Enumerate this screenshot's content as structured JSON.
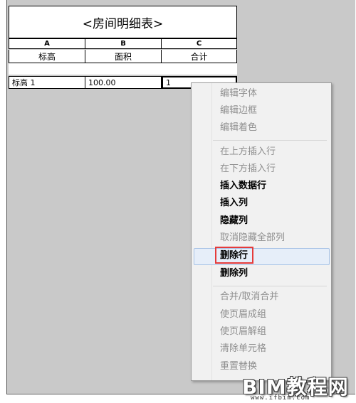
{
  "schedule": {
    "title": "<房间明细表>",
    "columns": [
      "A",
      "B",
      "C"
    ],
    "labels": [
      "标高",
      "面积",
      "合计"
    ],
    "row": [
      "标高 1",
      "100.00",
      "1"
    ]
  },
  "menu": {
    "items": [
      {
        "label": "编辑字体",
        "enabled": false
      },
      {
        "label": "编辑边框",
        "enabled": false
      },
      {
        "label": "编辑着色",
        "enabled": false
      },
      {
        "label": "在上方插入行",
        "enabled": false
      },
      {
        "label": "在下方插入行",
        "enabled": false
      },
      {
        "label": "插入数据行",
        "enabled": true
      },
      {
        "label": "插入列",
        "enabled": true
      },
      {
        "label": "隐藏列",
        "enabled": true
      },
      {
        "label": "取消隐藏全部列",
        "enabled": false
      },
      {
        "label": "删除行",
        "enabled": true
      },
      {
        "label": "删除列",
        "enabled": true
      },
      {
        "label": "合并/取消合并",
        "enabled": false
      },
      {
        "label": "使页眉成组",
        "enabled": false
      },
      {
        "label": "使页眉解组",
        "enabled": false
      },
      {
        "label": "清除单元格",
        "enabled": false
      },
      {
        "label": "重置替换",
        "enabled": false
      }
    ]
  },
  "watermark": {
    "brand": "BIM教程网",
    "url": "www.ifbim.com"
  }
}
